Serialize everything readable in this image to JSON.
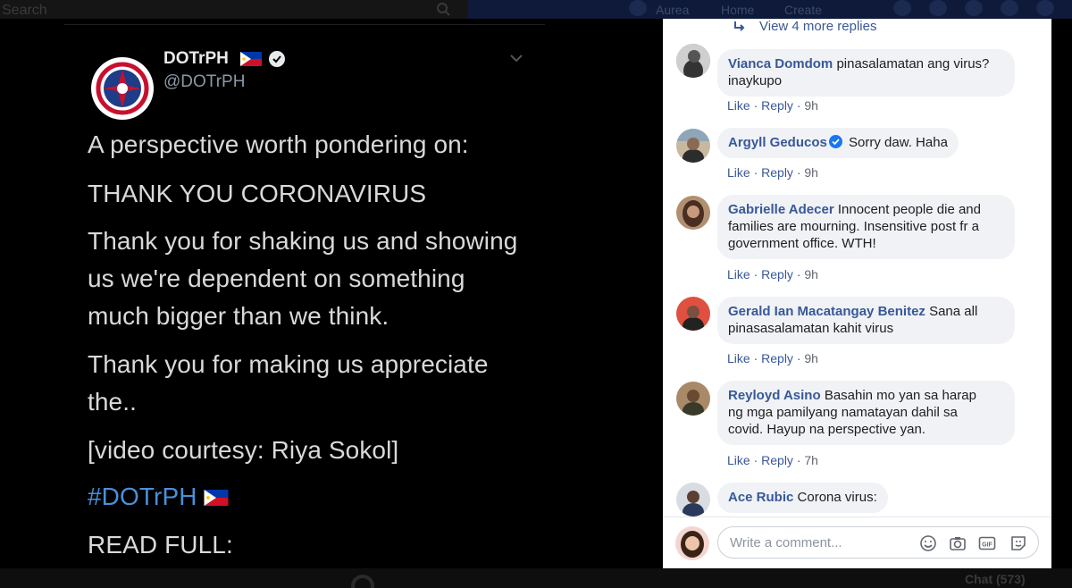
{
  "topbar": {
    "search_placeholder": "Search",
    "nav_user": "Aurea",
    "nav_home": "Home",
    "nav_create": "Create"
  },
  "tweet": {
    "name": "DOTrPH",
    "handle": "@DOTrPH",
    "lines": [
      "A perspective worth pondering on:",
      "THANK YOU CORONAVIRUS",
      "Thank you for shaking us and showing",
      "us we're dependent on something",
      "much bigger than we think.",
      "Thank you for making us appreciate",
      "the..",
      "[video courtesy: Riya Sokol]",
      "#DOTrPH",
      "READ FULL:"
    ]
  },
  "comments_panel": {
    "view_more": "View 4 more replies",
    "comments": [
      {
        "author": "Vianca Domdom",
        "text_1": "pinasalamatan ang virus?",
        "text_2": "inaykupo",
        "like": "Like",
        "reply": "Reply",
        "time": "9h"
      },
      {
        "author": "Argyll Geducos",
        "text_1": "Sorry daw. Haha",
        "like": "Like",
        "reply": "Reply",
        "time": "9h"
      },
      {
        "author": "Gabrielle Adecer",
        "text_1": "Innocent people die and",
        "text_2": "families are mourning. Insensitive post fr a",
        "text_3": "government office. WTH!",
        "like": "Like",
        "reply": "Reply",
        "time": "9h"
      },
      {
        "author": "Gerald Ian Macatangay Benitez",
        "text_1": "Sana all",
        "text_2": "pinasasalamatan kahit virus",
        "like": "Like",
        "reply": "Reply",
        "time": "9h"
      },
      {
        "author": "Reyloyd Asino",
        "text_1": "Basahin mo yan sa harap",
        "text_2": "ng mga pamilyang namatayan dahil sa",
        "text_3": "covid. Hayup na perspective yan.",
        "like": "Like",
        "reply": "Reply",
        "time": "7h"
      },
      {
        "author": "Ace Rubic",
        "text_1": "Corona virus:"
      }
    ],
    "write_placeholder": "Write a comment..."
  },
  "bottom": {
    "chat_label": "Chat (573)"
  },
  "colors": {
    "link_blue": "#385898",
    "bubble_bg": "#f0f2f5",
    "tweet_text": "#d9d9d9",
    "hashtag": "#4a90d9"
  }
}
